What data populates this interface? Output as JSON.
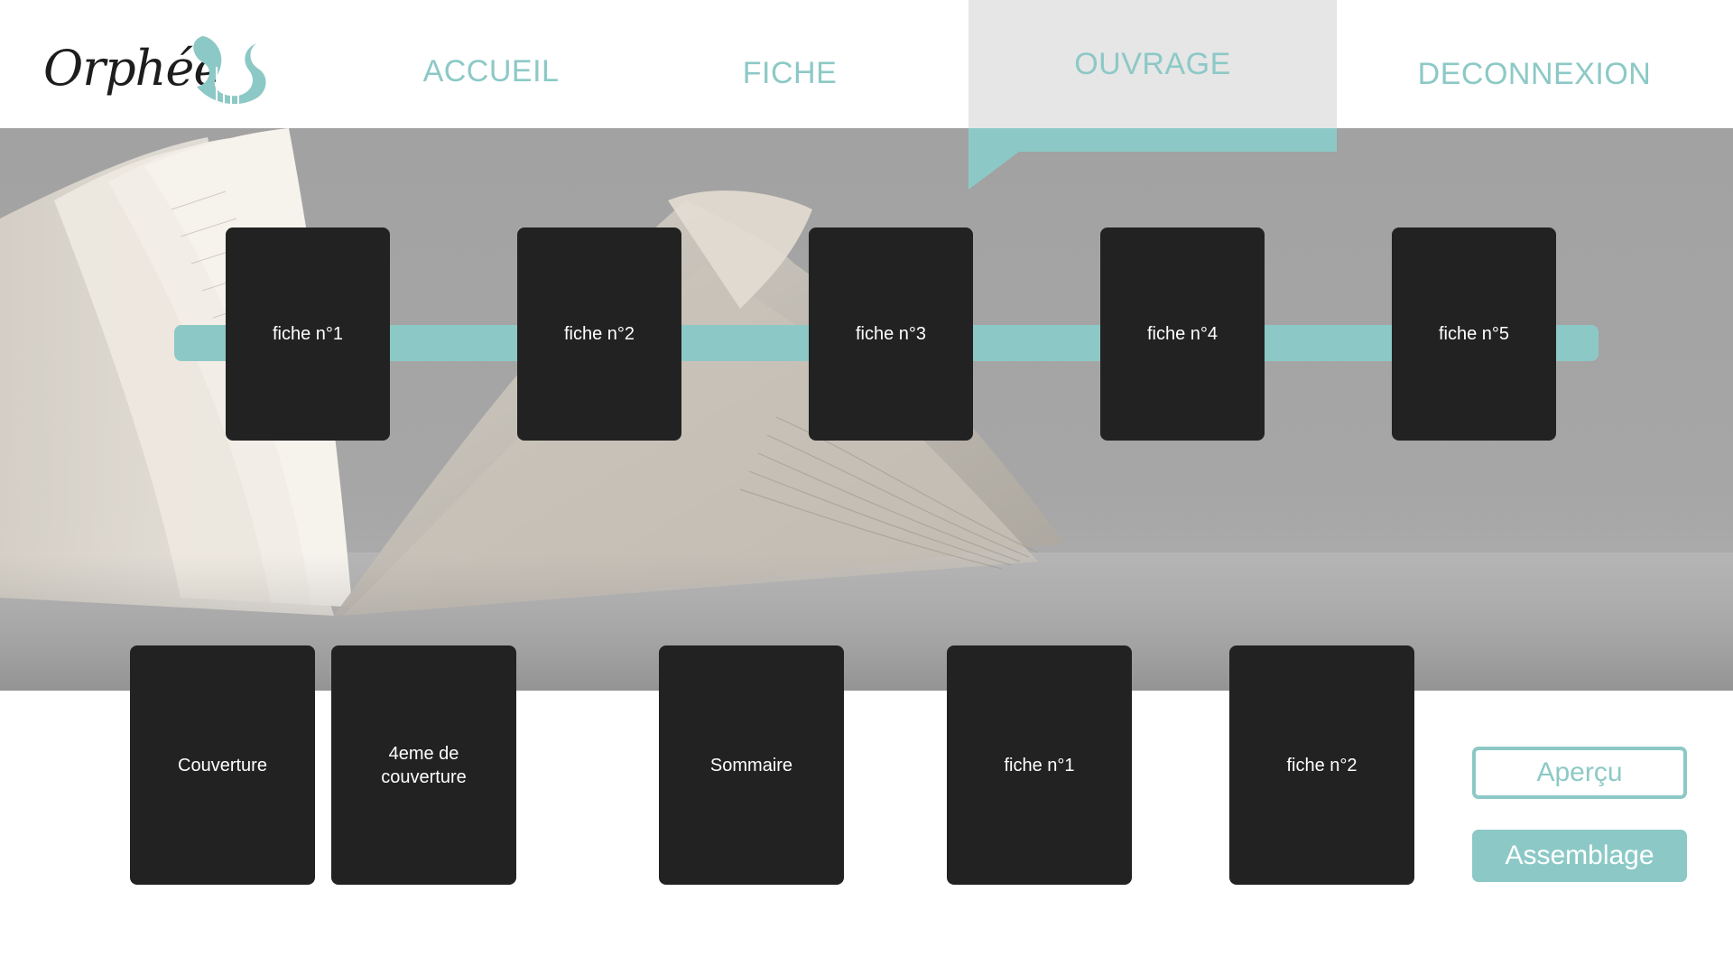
{
  "app": {
    "logo_text": "Orphée"
  },
  "nav": {
    "items": [
      {
        "label": "ACCUEIL",
        "active": false
      },
      {
        "label": "FICHE",
        "active": false
      },
      {
        "label": "OUVRAGE",
        "active": true
      },
      {
        "label": "DECONNEXION",
        "active": false
      }
    ]
  },
  "timeline": {
    "cards": [
      "fiche n°1",
      "fiche n°2",
      "fiche n°3",
      "fiche n°4",
      "fiche n°5"
    ]
  },
  "assembly": {
    "cards": [
      "Couverture",
      "4eme de couverture",
      "Sommaire",
      "fiche n°1",
      "fiche n°2"
    ]
  },
  "actions": {
    "apercu_label": "Aperçu",
    "assemblage_label": "Assemblage"
  },
  "colors": {
    "accent": "#8cc9c6",
    "card": "#222222",
    "nav_active_bg": "#e6e6e6"
  },
  "icons": {
    "logo": "lyre-icon"
  }
}
